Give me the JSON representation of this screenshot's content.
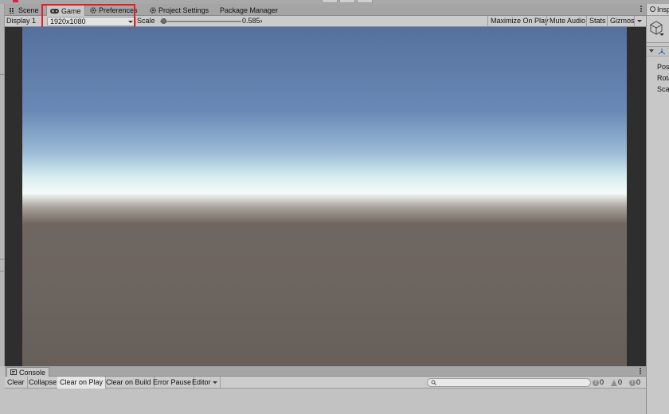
{
  "tabs": [
    {
      "label": "Scene",
      "icon": "scene-grid-icon"
    },
    {
      "label": "Game",
      "icon": "gamepad-icon"
    },
    {
      "label": "Preferences",
      "icon": "gear-icon"
    },
    {
      "label": "Project Settings",
      "icon": "gear-icon"
    },
    {
      "label": "Package Manager",
      "icon": ""
    }
  ],
  "toolbar": {
    "display": "Display 1",
    "resolution": "1920x1080",
    "scale_label": "Scale",
    "scale_value": "0.585",
    "maximize_on_play": "Maximize On Play",
    "mute_audio": "Mute Audio",
    "stats": "Stats",
    "gizmos": "Gizmos"
  },
  "scale_level": 0.585,
  "colors": {
    "highlight": "#e0202a",
    "sky_top": "#55709c",
    "horizon": "#f4fbf8",
    "ground": "#6d6560"
  },
  "inspector": {
    "tab_label": "Inspector",
    "transform_rows": [
      "Position",
      "Rotation",
      "Scale"
    ]
  },
  "console": {
    "tab_label": "Console",
    "buttons": [
      "Clear",
      "Collapse",
      "Clear on Play",
      "Clear on Build",
      "Error Pause",
      "Editor"
    ],
    "search_placeholder": "",
    "log_count": "0",
    "warning_count": "0",
    "error_count": "0"
  }
}
